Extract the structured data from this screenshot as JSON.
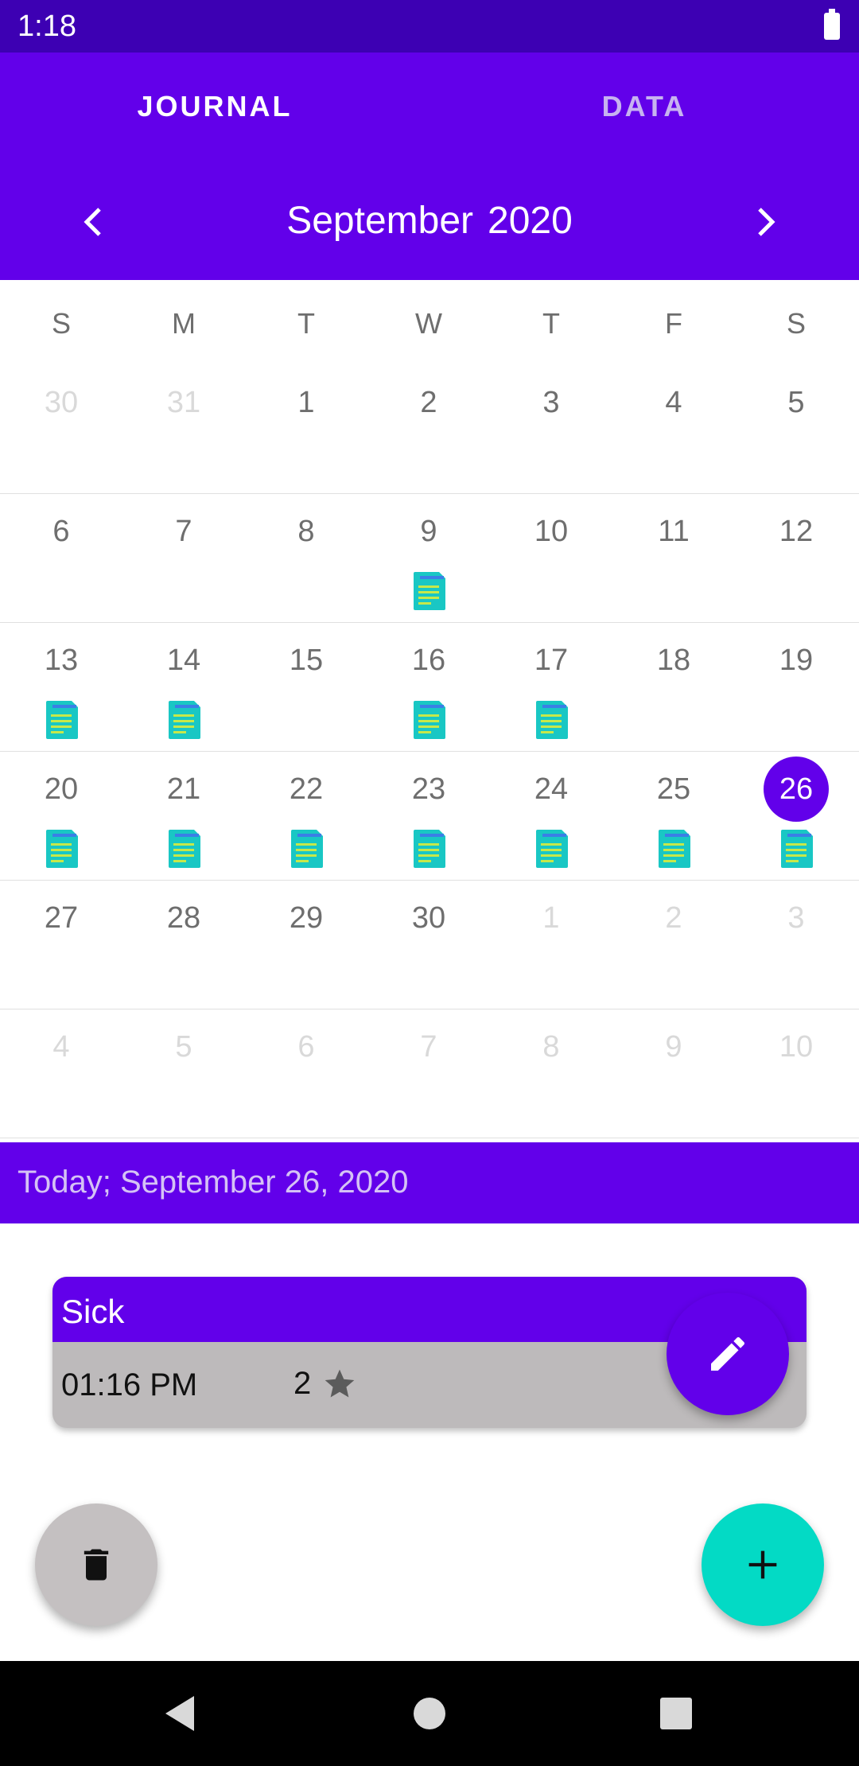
{
  "status_bar": {
    "time": "1:18",
    "battery_icon": "battery-full-icon"
  },
  "tabs": [
    {
      "label": "JOURNAL",
      "active": true
    },
    {
      "label": "DATA",
      "active": false
    }
  ],
  "calendar": {
    "month": "September",
    "year": "2020",
    "prev_icon": "chevron-left-icon",
    "next_icon": "chevron-right-icon",
    "weekdays": [
      "S",
      "M",
      "T",
      "W",
      "T",
      "F",
      "S"
    ],
    "entry_icon": "note-document-icon",
    "weeks": [
      [
        {
          "day": "30",
          "current": false,
          "entry": false
        },
        {
          "day": "31",
          "current": false,
          "entry": false
        },
        {
          "day": "1",
          "current": true,
          "entry": false
        },
        {
          "day": "2",
          "current": true,
          "entry": false
        },
        {
          "day": "3",
          "current": true,
          "entry": false
        },
        {
          "day": "4",
          "current": true,
          "entry": false
        },
        {
          "day": "5",
          "current": true,
          "entry": false
        }
      ],
      [
        {
          "day": "6",
          "current": true,
          "entry": false
        },
        {
          "day": "7",
          "current": true,
          "entry": false
        },
        {
          "day": "8",
          "current": true,
          "entry": false
        },
        {
          "day": "9",
          "current": true,
          "entry": true
        },
        {
          "day": "10",
          "current": true,
          "entry": false
        },
        {
          "day": "11",
          "current": true,
          "entry": false
        },
        {
          "day": "12",
          "current": true,
          "entry": false
        }
      ],
      [
        {
          "day": "13",
          "current": true,
          "entry": true
        },
        {
          "day": "14",
          "current": true,
          "entry": true
        },
        {
          "day": "15",
          "current": true,
          "entry": false
        },
        {
          "day": "16",
          "current": true,
          "entry": true
        },
        {
          "day": "17",
          "current": true,
          "entry": true
        },
        {
          "day": "18",
          "current": true,
          "entry": false
        },
        {
          "day": "19",
          "current": true,
          "entry": false
        }
      ],
      [
        {
          "day": "20",
          "current": true,
          "entry": true
        },
        {
          "day": "21",
          "current": true,
          "entry": true
        },
        {
          "day": "22",
          "current": true,
          "entry": true
        },
        {
          "day": "23",
          "current": true,
          "entry": true
        },
        {
          "day": "24",
          "current": true,
          "entry": true
        },
        {
          "day": "25",
          "current": true,
          "entry": true
        },
        {
          "day": "26",
          "current": true,
          "entry": true,
          "selected": true
        }
      ],
      [
        {
          "day": "27",
          "current": true,
          "entry": false
        },
        {
          "day": "28",
          "current": true,
          "entry": false
        },
        {
          "day": "29",
          "current": true,
          "entry": false
        },
        {
          "day": "30",
          "current": true,
          "entry": false
        },
        {
          "day": "1",
          "current": false,
          "entry": false
        },
        {
          "day": "2",
          "current": false,
          "entry": false
        },
        {
          "day": "3",
          "current": false,
          "entry": false
        }
      ],
      [
        {
          "day": "4",
          "current": false,
          "entry": false
        },
        {
          "day": "5",
          "current": false,
          "entry": false
        },
        {
          "day": "6",
          "current": false,
          "entry": false
        },
        {
          "day": "7",
          "current": false,
          "entry": false
        },
        {
          "day": "8",
          "current": false,
          "entry": false
        },
        {
          "day": "9",
          "current": false,
          "entry": false
        },
        {
          "day": "10",
          "current": false,
          "entry": false
        }
      ]
    ]
  },
  "today_banner": "Today; September 26, 2020",
  "entry": {
    "title": "Sick",
    "time": "01:16 PM",
    "rating": "2",
    "rating_icon": "star-icon"
  },
  "fabs": {
    "edit_icon": "pencil-icon",
    "delete_icon": "trash-icon",
    "add_icon": "plus-icon"
  },
  "nav_bar": [
    "back-icon",
    "home-icon",
    "recents-icon"
  ],
  "colors": {
    "primary": "#6200ea",
    "status_bar": "#3d00b3",
    "accent": "#03dac5",
    "card_body": "#bdbabb"
  }
}
